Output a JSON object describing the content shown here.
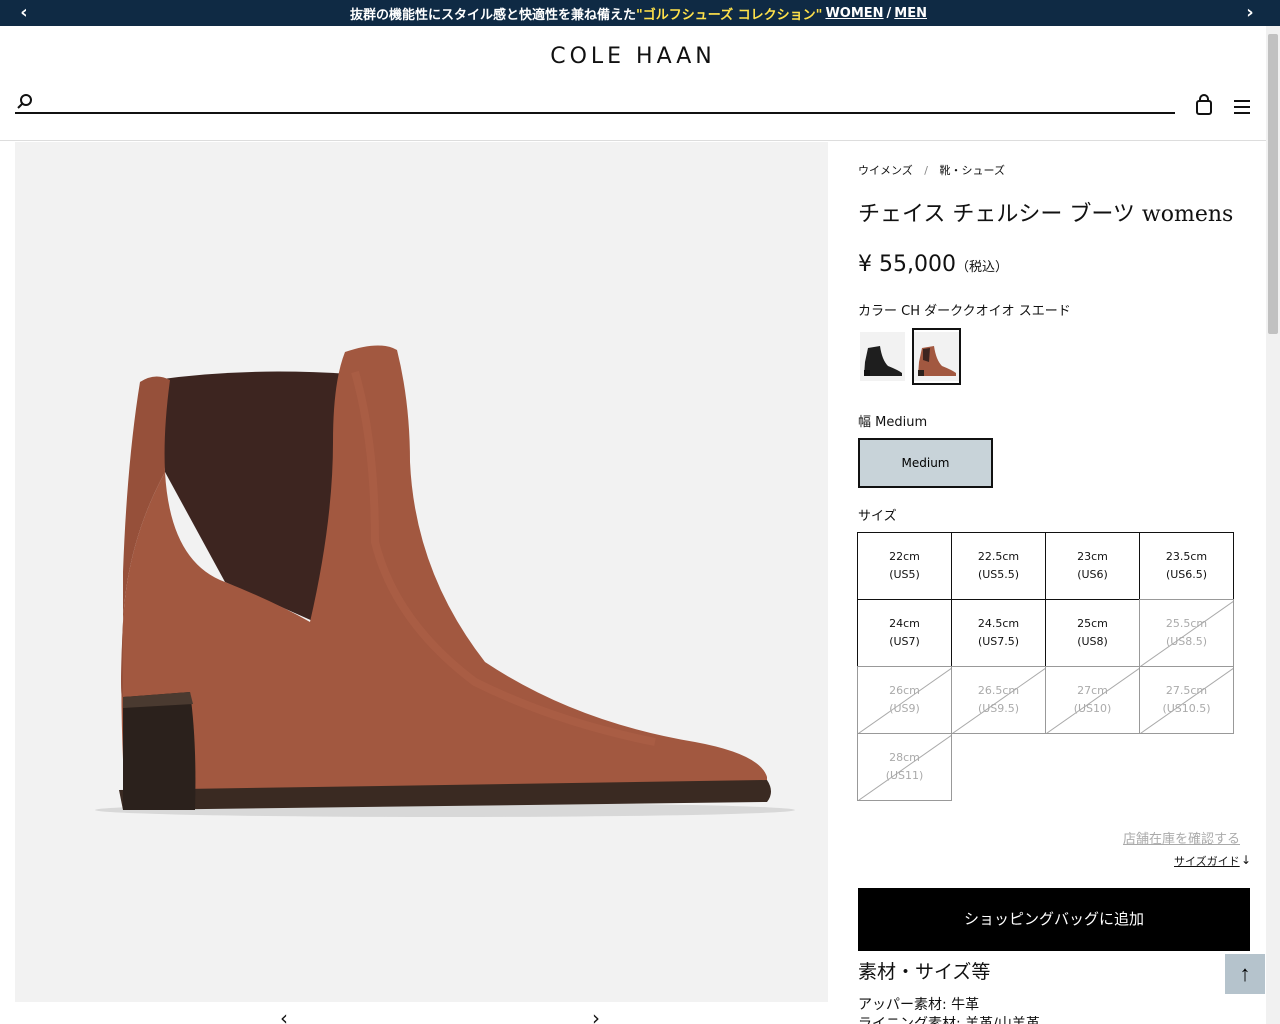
{
  "promo": {
    "text": "抜群の機能性にスタイル感と快適性を兼ね備えた",
    "highlight": "\"ゴルフシューズ コレクション\"",
    "women_link": "WOMEN",
    "separator": "/",
    "men_link": "MEN",
    "prev_arrow": "‹",
    "next_arrow": "›"
  },
  "header": {
    "logo": "COLE HAAN",
    "search_placeholder": "",
    "icons": [
      "search-icon",
      "bag-icon",
      "hamburger-menu-icon"
    ]
  },
  "breadcrumb": {
    "items": [
      "ウイメンズ",
      "靴・シューズ"
    ],
    "separator": "/"
  },
  "product": {
    "title": "チェイス チェルシー ブーツ womens",
    "price": "¥ 55,000",
    "tax_note": "（税込）",
    "color_label": "カラー CH ダーククオイオ スエード",
    "swatches": [
      {
        "name": "black",
        "selected": false
      },
      {
        "name": "dark-cuoio-suede",
        "selected": true
      }
    ],
    "width_label": "幅 Medium",
    "width_option": "Medium",
    "size_label": "サイズ",
    "sizes": [
      {
        "cm": "22cm",
        "us": "(US5)",
        "available": true
      },
      {
        "cm": "22.5cm",
        "us": "(US5.5)",
        "available": true
      },
      {
        "cm": "23cm",
        "us": "(US6)",
        "available": true
      },
      {
        "cm": "23.5cm",
        "us": "(US6.5)",
        "available": true
      },
      {
        "cm": "24cm",
        "us": "(US7)",
        "available": true
      },
      {
        "cm": "24.5cm",
        "us": "(US7.5)",
        "available": true
      },
      {
        "cm": "25cm",
        "us": "(US8)",
        "available": true
      },
      {
        "cm": "25.5cm",
        "us": "(US8.5)",
        "available": false
      },
      {
        "cm": "26cm",
        "us": "(US9)",
        "available": false
      },
      {
        "cm": "26.5cm",
        "us": "(US9.5)",
        "available": false
      },
      {
        "cm": "27cm",
        "us": "(US10)",
        "available": false
      },
      {
        "cm": "27.5cm",
        "us": "(US10.5)",
        "available": false
      },
      {
        "cm": "28cm",
        "us": "(US11)",
        "available": false
      }
    ],
    "store_stock_link": "店舗在庫を確認する",
    "size_guide_link": "サイズガイド",
    "size_guide_arrow": "↓",
    "add_to_bag": "ショッピングバッグに追加",
    "material_heading": "素材・サイズ等",
    "upper_material": "アッパー素材: 牛革",
    "lining_material": "ライニング素材: 羊革/山羊革"
  },
  "carousel": {
    "prev": "‹",
    "next": "›"
  },
  "back_to_top": "↑"
}
